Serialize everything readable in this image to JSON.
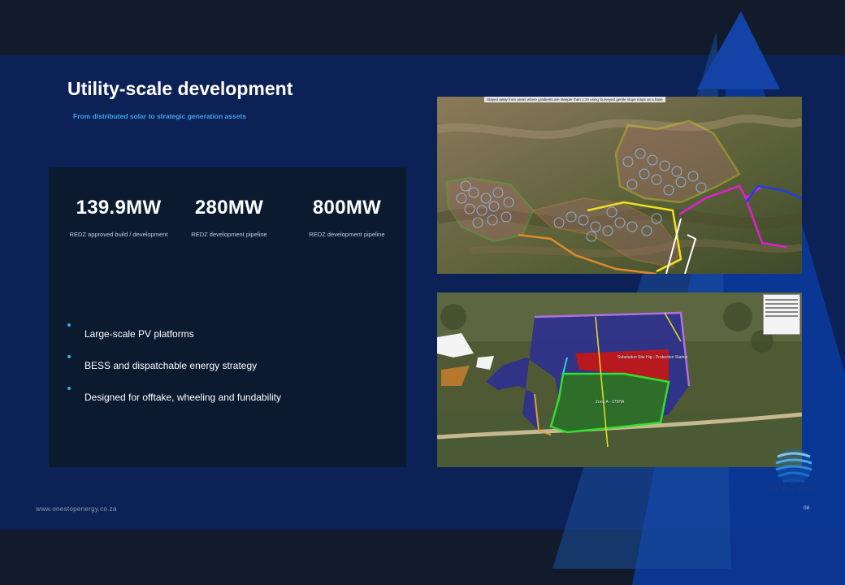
{
  "slide": {
    "title": "Utility-scale development",
    "subtitle": "From distributed solar to strategic generation assets",
    "page_number": "08",
    "footer_url": "www.onestopenergy.co.za"
  },
  "stats": [
    {
      "value": "139.9MW",
      "label": "REDZ approved build / development"
    },
    {
      "value": "280MW",
      "label": "REDZ development pipeline"
    },
    {
      "value": "800MW",
      "label": "REDZ development pipeline"
    }
  ],
  "bullets": [
    {
      "text": "Large-scale PV platforms"
    },
    {
      "text": "BESS and dispatchable energy strategy"
    },
    {
      "text": "Designed for offtake, wheeling and fundability"
    }
  ],
  "maps": {
    "top_note": "Stayed away from areas where gradients are steeper than 1:10 using Surveyed gentle slope maps as a base",
    "bottom_labels": [
      "Zone A - 175HA",
      "Substation Site Hig - Protection Station"
    ]
  },
  "logo": {
    "name": "ONE STOP ENERGY",
    "icon": "globe-icon"
  },
  "colors": {
    "background": "#0c2155",
    "panel": "#0c1a30",
    "accent": "#3fa6e8",
    "band": "#111b2b"
  }
}
